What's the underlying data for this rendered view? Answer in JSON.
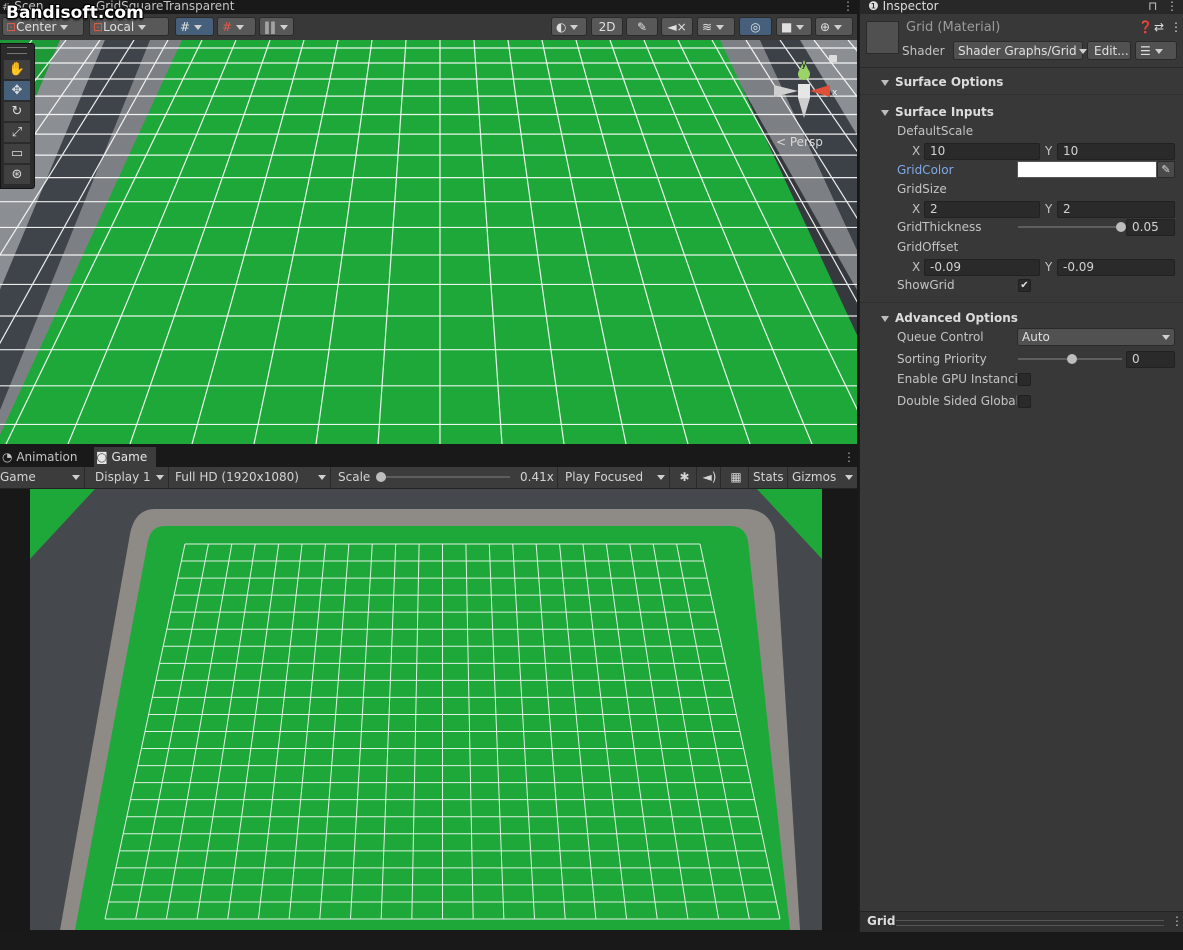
{
  "watermark": "Bandisoft.com",
  "scene": {
    "tabs": [
      "Scen",
      "GridSquareTransparent"
    ],
    "toolbar": {
      "pivot": "Center",
      "space": "Local",
      "mode_2d": "2D"
    },
    "persp_label": "< Persp",
    "gizmo_axes": {
      "y": "y",
      "x": "x"
    }
  },
  "game": {
    "tabs": [
      "Animation",
      "Game"
    ],
    "toolbar": {
      "view": "Game",
      "display": "Display 1",
      "resolution": "Full HD (1920x1080)",
      "scale_label": "Scale",
      "scale_value": "0.41x",
      "play_mode": "Play Focused",
      "stats": "Stats",
      "gizmos": "Gizmos"
    }
  },
  "inspector": {
    "tab_title": "Inspector",
    "material_name": "Grid (Material)",
    "shader_label": "Shader",
    "shader_value": "Shader Graphs/Grid",
    "edit_button": "Edit...",
    "sections": {
      "surface_options": "Surface Options",
      "surface_inputs": "Surface Inputs",
      "advanced_options": "Advanced Options"
    },
    "properties": {
      "default_scale": {
        "label": "DefaultScale",
        "x_label": "X",
        "x": "10",
        "y_label": "Y",
        "y": "10"
      },
      "grid_color": {
        "label": "GridColor",
        "color": "#ffffff"
      },
      "grid_size": {
        "label": "GridSize",
        "x_label": "X",
        "x": "2",
        "y_label": "Y",
        "y": "2"
      },
      "grid_thickness": {
        "label": "GridThickness",
        "value": "0.05",
        "slider_fraction": 1.0
      },
      "grid_offset": {
        "label": "GridOffset",
        "x_label": "X",
        "x": "-0.09",
        "y_label": "Y",
        "y": "-0.09"
      },
      "show_grid": {
        "label": "ShowGrid",
        "checked": true,
        "check_glyph": "✔"
      }
    },
    "advanced": {
      "queue_control": {
        "label": "Queue Control",
        "value": "Auto"
      },
      "sorting_priority": {
        "label": "Sorting Priority",
        "value": "0",
        "slider_fraction": 0.5
      },
      "gpu_instancing": {
        "label": "Enable GPU Instancir",
        "checked": false
      },
      "double_sided": {
        "label": "Double Sided Global I",
        "checked": false
      }
    },
    "footer_label": "Grid"
  },
  "colors": {
    "grass": "#1fa83a",
    "grid_line": "#ffffff",
    "link_blue": "#7fa9e6",
    "active_blue": "#46607c"
  }
}
